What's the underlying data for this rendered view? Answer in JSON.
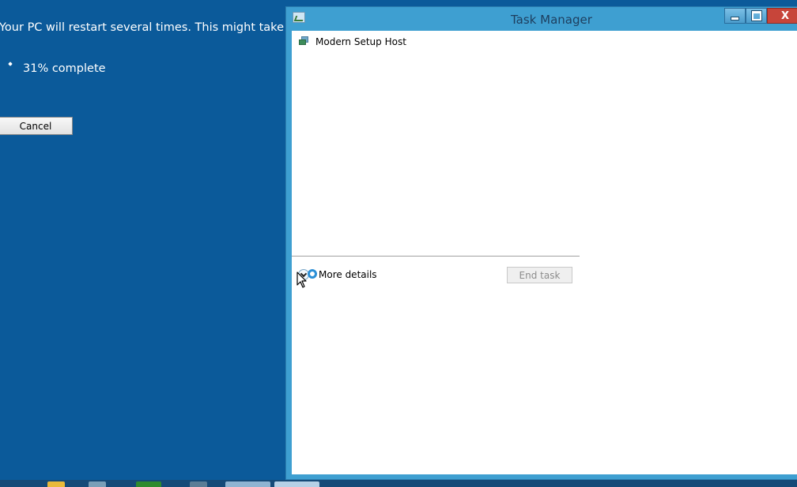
{
  "setup": {
    "message": "Your PC will restart several times. This might take a whi",
    "progress_text": "31% complete",
    "cancel_label": "Cancel"
  },
  "task_manager": {
    "title": "Task Manager",
    "controls": {
      "minimize_icon": "minimize-icon",
      "maximize_icon": "maximize-icon",
      "close_glyph": "X"
    },
    "tasks": [
      {
        "name": "Modern Setup Host",
        "icon": "setup-host-icon"
      }
    ],
    "more_details_label": "More details",
    "end_task_label": "End task"
  },
  "colors": {
    "desktop_background": "#0b5a9a",
    "window_frame": "#3e9fd1",
    "close_button": "#c7453a"
  }
}
